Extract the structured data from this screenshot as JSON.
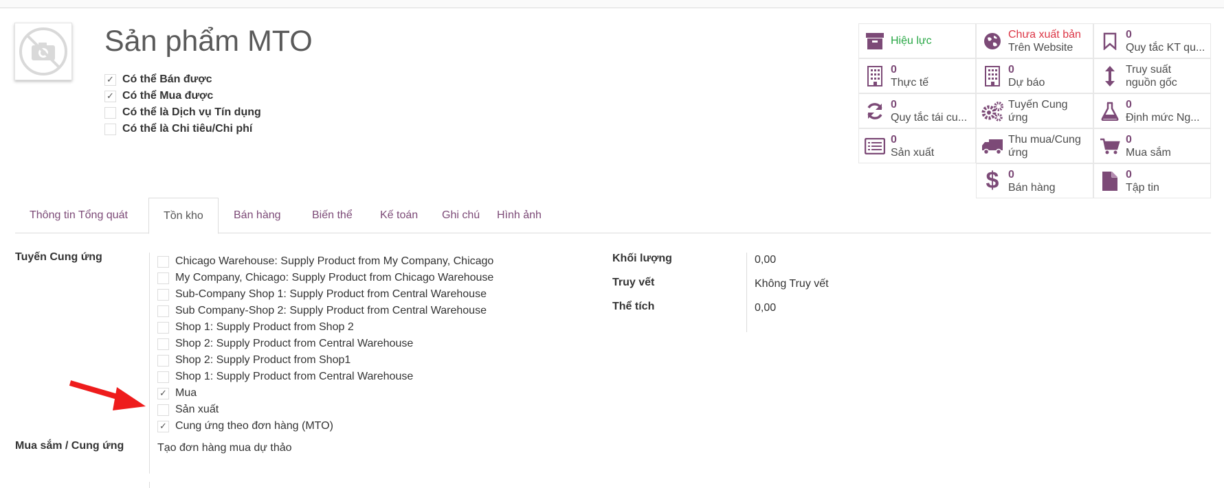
{
  "product": {
    "title": "Sản phẩm MTO",
    "checkboxes": [
      {
        "label": "Có thể Bán được",
        "checked": true
      },
      {
        "label": "Có thể Mua được",
        "checked": true
      },
      {
        "label": "Có thể là Dịch vụ Tín dụng",
        "checked": false
      },
      {
        "label": "Có thể là Chi tiêu/Chi phí",
        "checked": false
      }
    ]
  },
  "stats": {
    "active": {
      "label": "Hiệu lực",
      "color": "#28a745"
    },
    "website": {
      "line1": "Chưa xuất bản",
      "line2": "Trên Website",
      "color": "#dc3545"
    },
    "putaway": {
      "num": "0",
      "label": "Quy tắc KT qu..."
    },
    "onhand": {
      "num": "0",
      "label": "Thực tế"
    },
    "forecast": {
      "num": "0",
      "label": "Dự báo"
    },
    "traceability": {
      "line1": "Truy suất",
      "line2": "nguồn gốc"
    },
    "reordering": {
      "num": "0",
      "label": "Quy tắc tái cu..."
    },
    "routes": {
      "line1": "Tuyến Cung",
      "line2": "ứng"
    },
    "bom": {
      "num": "0",
      "label": "Định mức Ng..."
    },
    "manufacturing": {
      "num": "0",
      "label": "Sản xuất"
    },
    "supply": {
      "line1": "Thu mua/Cung",
      "line2": "ứng"
    },
    "purchase": {
      "num": "0",
      "label": "Mua sắm"
    },
    "sales": {
      "num": "0",
      "label": "Bán hàng"
    },
    "files": {
      "num": "0",
      "label": "Tập tin"
    }
  },
  "tabs": [
    "Thông tin Tổng quát",
    "Tồn kho",
    "Bán hàng",
    "Biến thể",
    "Kế toán",
    "Ghi chú",
    "Hình ảnh"
  ],
  "inventory": {
    "routes_label": "Tuyến Cung ứng",
    "routes": [
      {
        "label": "Chicago Warehouse: Supply Product from My Company, Chicago",
        "checked": false
      },
      {
        "label": "My Company, Chicago: Supply Product from Chicago Warehouse",
        "checked": false
      },
      {
        "label": "Sub-Company Shop 1: Supply Product from Central Warehouse",
        "checked": false
      },
      {
        "label": "Sub Company-Shop 2: Supply Product from Central Warehouse",
        "checked": false
      },
      {
        "label": "Shop 1: Supply Product from Shop 2",
        "checked": false
      },
      {
        "label": "Shop 2: Supply Product from Central Warehouse",
        "checked": false
      },
      {
        "label": "Shop 2: Supply Product from Shop1",
        "checked": false
      },
      {
        "label": "Shop 1: Supply Product from Central Warehouse",
        "checked": false
      },
      {
        "label": "Mua",
        "checked": true
      },
      {
        "label": "Sản xuất",
        "checked": false
      },
      {
        "label": "Cung ứng theo đơn hàng (MTO)",
        "checked": true
      }
    ],
    "procurement_label": "Mua sắm / Cung ứng",
    "procurement_value": "Tạo đơn hàng mua dự thảo",
    "weight_label": "Khối lượng",
    "weight_value": "0,00",
    "tracking_label": "Truy vết",
    "tracking_value": "Không Truy vết",
    "volume_label": "Thể tích",
    "volume_value": "0,00"
  },
  "colors": {
    "accent": "#7c4a77",
    "arrow": "#ee1c1c"
  }
}
